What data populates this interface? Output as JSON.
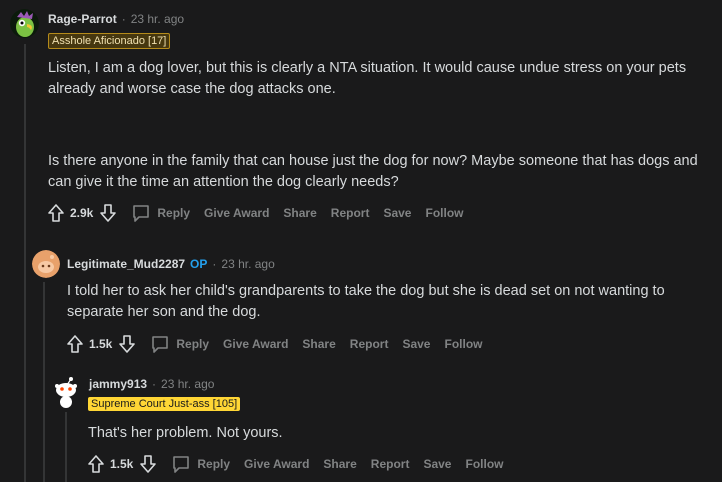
{
  "comments": [
    {
      "username": "Rage-Parrot",
      "time": "23 hr. ago",
      "flair": "Asshole Aficionado [17]",
      "paragraphs": [
        "Listen, I am a dog lover, but this is clearly a NTA situation. It would cause undue stress on your pets already and worse case the dog attacks one.",
        "Is there anyone in the family that can house just the dog for now? Maybe someone that has dogs and can give it the time an attention the dog clearly needs?"
      ],
      "score": "2.9k"
    },
    {
      "username": "Legitimate_Mud2287",
      "op_badge": "OP",
      "time": "23 hr. ago",
      "paragraphs": [
        "I told her to ask her child's grandparents to take the dog but she is dead set on not wanting to separate her son and the dog."
      ],
      "score": "1.5k"
    },
    {
      "username": "jammy913",
      "time": "23 hr. ago",
      "flair": "Supreme Court Just-ass [105]",
      "paragraphs": [
        "That's her problem. Not yours."
      ],
      "score": "1.5k"
    }
  ],
  "actions": {
    "reply": "Reply",
    "give_award": "Give Award",
    "share": "Share",
    "report": "Report",
    "save": "Save",
    "follow": "Follow"
  },
  "separator": "·",
  "colors": {
    "background": "#1a1a1b",
    "text": "#d7dadc",
    "muted": "#818384",
    "op": "#24a0ed",
    "flair_gold": "#ffd635"
  }
}
